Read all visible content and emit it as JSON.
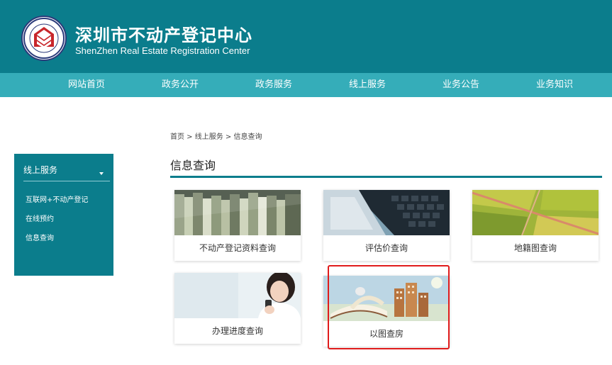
{
  "header": {
    "title": "深圳市不动产登记中心",
    "subtitle": "ShenZhen Real Estate Registration Center",
    "logo_icon": "registration-seal-icon"
  },
  "nav": {
    "items": [
      "网站首页",
      "政务公开",
      "政务服务",
      "线上服务",
      "业务公告",
      "业务知识"
    ]
  },
  "breadcrumb": "首页 > 线上服务 > 信息查询",
  "page_title": "信息查询",
  "sidebar": {
    "heading": "线上服务",
    "items": [
      "互联网+不动产登记",
      "在线预约",
      "信息查询"
    ]
  },
  "cards": [
    {
      "label": "不动产登记资料查询",
      "image": "file-folders-image"
    },
    {
      "label": "评估价查询",
      "image": "laptop-keyboard-image"
    },
    {
      "label": "地籍图查询",
      "image": "aerial-farmland-image"
    },
    {
      "label": "办理进度查询",
      "image": "woman-with-phone-image"
    },
    {
      "label": "以图查房",
      "image": "book-and-buildings-image"
    }
  ],
  "colors": {
    "header_bg": "#0b7d8c",
    "nav_bg": "#35adb9",
    "highlight": "#e01b1b"
  }
}
